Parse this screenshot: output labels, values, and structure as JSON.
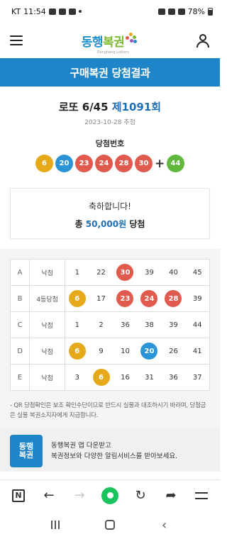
{
  "status_bar": {
    "carrier": "KT",
    "time": "11:54",
    "battery": "78%"
  },
  "header": {
    "logo_text_a": "동행",
    "logo_text_b": "복권",
    "logo_sub": "Donghang Lottery"
  },
  "banner": {
    "title": "구매복권 당첨결과"
  },
  "draw": {
    "game": "로또 6/45",
    "round": "제1091회",
    "date": "2023-10-28 추첨",
    "win_label": "당첨번호",
    "numbers": [
      {
        "n": "6",
        "color": "#e5a91a"
      },
      {
        "n": "20",
        "color": "#2b94d6"
      },
      {
        "n": "23",
        "color": "#e05a4e"
      },
      {
        "n": "24",
        "color": "#e05a4e"
      },
      {
        "n": "28",
        "color": "#e05a4e"
      },
      {
        "n": "30",
        "color": "#e05a4e"
      }
    ],
    "plus": "+",
    "bonus": {
      "n": "44",
      "color": "#5fb83c"
    }
  },
  "result": {
    "congrats": "축하합니다!",
    "prefix": "총",
    "amount": "50,000원",
    "suffix": "당첨"
  },
  "tickets": [
    {
      "id": "A",
      "status": "낙첨",
      "nums": [
        {
          "n": "1",
          "hit": null
        },
        {
          "n": "22",
          "hit": null
        },
        {
          "n": "30",
          "hit": "#e05a4e"
        },
        {
          "n": "39",
          "hit": null
        },
        {
          "n": "40",
          "hit": null
        },
        {
          "n": "45",
          "hit": null
        }
      ]
    },
    {
      "id": "B",
      "status": "4등당첨",
      "nums": [
        {
          "n": "6",
          "hit": "#e5a91a"
        },
        {
          "n": "17",
          "hit": null
        },
        {
          "n": "23",
          "hit": "#e05a4e"
        },
        {
          "n": "24",
          "hit": "#e05a4e"
        },
        {
          "n": "28",
          "hit": "#e05a4e"
        },
        {
          "n": "39",
          "hit": null
        }
      ]
    },
    {
      "id": "C",
      "status": "낙첨",
      "nums": [
        {
          "n": "1",
          "hit": null
        },
        {
          "n": "2",
          "hit": null
        },
        {
          "n": "36",
          "hit": null
        },
        {
          "n": "38",
          "hit": null
        },
        {
          "n": "39",
          "hit": null
        },
        {
          "n": "44",
          "hit": null
        }
      ]
    },
    {
      "id": "D",
      "status": "낙첨",
      "nums": [
        {
          "n": "6",
          "hit": "#e5a91a"
        },
        {
          "n": "9",
          "hit": null
        },
        {
          "n": "10",
          "hit": null
        },
        {
          "n": "20",
          "hit": "#2b94d6"
        },
        {
          "n": "26",
          "hit": null
        },
        {
          "n": "41",
          "hit": null
        }
      ]
    },
    {
      "id": "E",
      "status": "낙첨",
      "nums": [
        {
          "n": "3",
          "hit": null
        },
        {
          "n": "6",
          "hit": "#e5a91a"
        },
        {
          "n": "16",
          "hit": null
        },
        {
          "n": "31",
          "hit": null
        },
        {
          "n": "36",
          "hit": null
        },
        {
          "n": "37",
          "hit": null
        }
      ]
    }
  ],
  "note": "- QR 당첨확인은 보조 확인수단이므로 반드시 실물과 대조하시기 바라며, 당첨금은 실물 복권소지자에게 지급합니다.",
  "app_promo": {
    "tile_a": "동행",
    "tile_b": "복권",
    "line1": "동행복권 앱 다운받고",
    "line2": "복권정보와 다양한 알림서비스를 받아보세요."
  },
  "browser": {
    "n_label": "N",
    "back": "←",
    "forward": "→",
    "reload": "↻",
    "share": "➦"
  },
  "colors": {
    "accent": "#1e86c8",
    "round_blue": "#1e6fb5"
  }
}
